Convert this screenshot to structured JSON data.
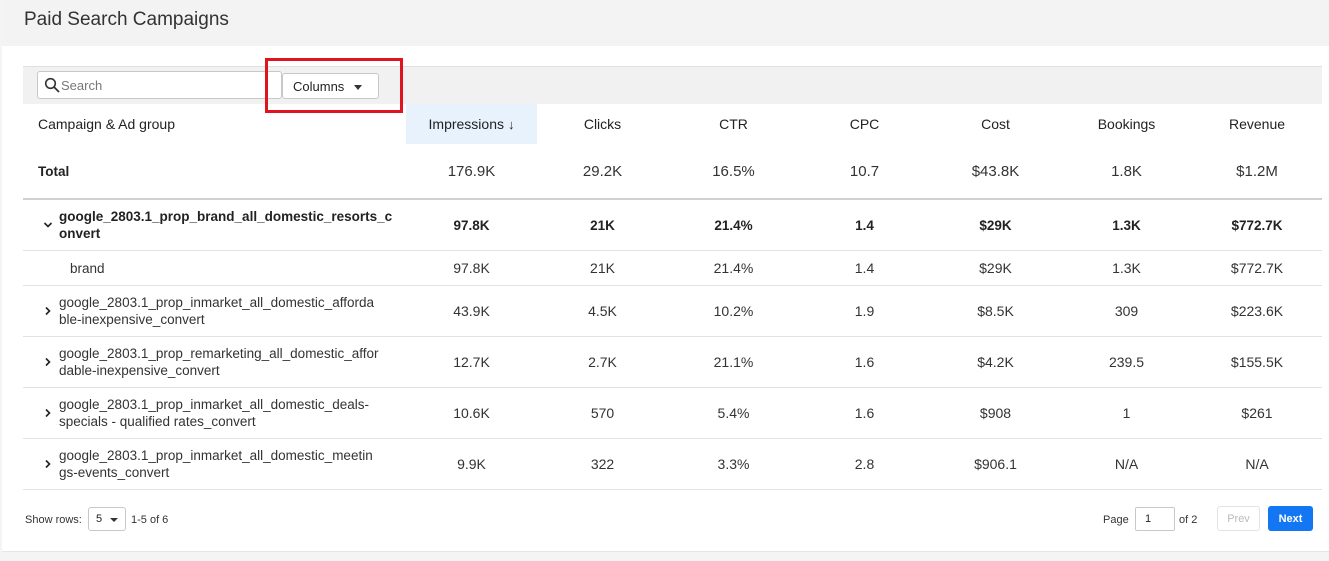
{
  "page": {
    "title": "Paid Search Campaigns"
  },
  "toolbar": {
    "search_placeholder": "Search",
    "columns_label": "Columns"
  },
  "table": {
    "columns": [
      "Campaign & Ad group",
      "Impressions",
      "Clicks",
      "CTR",
      "CPC",
      "Cost",
      "Bookings",
      "Revenue"
    ],
    "sort_indicator": "↓",
    "total": {
      "label": "Total",
      "values": [
        "176.9K",
        "29.2K",
        "16.5%",
        "10.7",
        "$43.8K",
        "1.8K",
        "$1.2M"
      ]
    },
    "rows": [
      {
        "name_line1": "google_2803.1_prop_brand_all_domestic_resorts_c",
        "name_line2": "onvert",
        "expanded": true,
        "values": [
          "97.8K",
          "21K",
          "21.4%",
          "1.4",
          "$29K",
          "1.3K",
          "$772.7K"
        ]
      },
      {
        "name": "brand",
        "values": [
          "97.8K",
          "21K",
          "21.4%",
          "1.4",
          "$29K",
          "1.3K",
          "$772.7K"
        ]
      },
      {
        "name_line1": "google_2803.1_prop_inmarket_all_domestic_afforda",
        "name_line2": "ble-inexpensive_convert",
        "expanded": false,
        "values": [
          "43.9K",
          "4.5K",
          "10.2%",
          "1.9",
          "$8.5K",
          "309",
          "$223.6K"
        ]
      },
      {
        "name_line1": "google_2803.1_prop_remarketing_all_domestic_affor",
        "name_line2": "dable-inexpensive_convert",
        "expanded": false,
        "values": [
          "12.7K",
          "2.7K",
          "21.1%",
          "1.6",
          "$4.2K",
          "239.5",
          "$155.5K"
        ]
      },
      {
        "name_line1": "google_2803.1_prop_inmarket_all_domestic_deals-",
        "name_line2": "specials - qualified rates_convert",
        "expanded": false,
        "values": [
          "10.6K",
          "570",
          "5.4%",
          "1.6",
          "$908",
          "1",
          "$261"
        ]
      },
      {
        "name_line1": "google_2803.1_prop_inmarket_all_domestic_meetin",
        "name_line2": "gs-events_convert",
        "expanded": false,
        "values": [
          "9.9K",
          "322",
          "3.3%",
          "2.8",
          "$906.1",
          "N/A",
          "N/A"
        ]
      }
    ]
  },
  "footer": {
    "show_rows_label": "Show rows:",
    "rows_value": "5",
    "range": "1-5 of 6",
    "page_label": "Page",
    "page_value": "1",
    "of_label": "of 2",
    "prev_label": "Prev",
    "next_label": "Next"
  },
  "colors": {
    "accent": "#1376f2",
    "highlight": "#e0141e",
    "sorted_header": "#e7f2fd"
  }
}
